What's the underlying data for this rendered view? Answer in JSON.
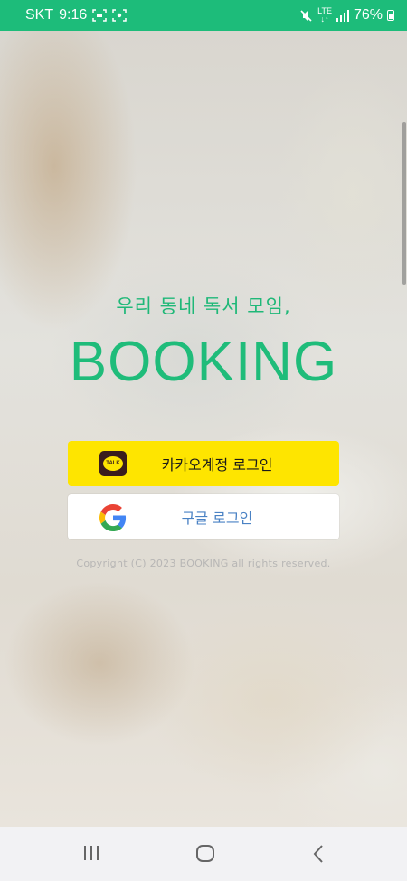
{
  "status_bar": {
    "carrier": "SKT",
    "time": "9:16",
    "network": "LTE",
    "battery": "76%"
  },
  "main": {
    "tagline": "우리 동네 독서 모임,",
    "logo": "BOOKING",
    "kakao_button": {
      "label": "카카오계정 로그인",
      "icon_text": "TALK",
      "color": "#fee500"
    },
    "google_button": {
      "label": "구글 로그인"
    },
    "copyright": "Copyright (C) 2023 BOOKING all rights reserved."
  },
  "colors": {
    "brand": "#1fbc7a",
    "status_bar": "#1dbc7a",
    "kakao": "#fee500",
    "google_text": "#4a82c4"
  },
  "nav_bar": {
    "icons": [
      "recent-apps-icon",
      "home-icon",
      "back-icon"
    ]
  }
}
